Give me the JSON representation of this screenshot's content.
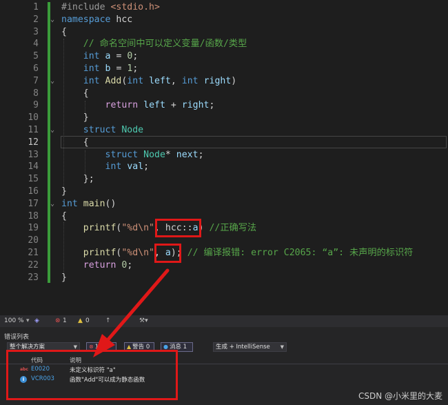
{
  "editor": {
    "lines": [
      {
        "n": "1",
        "html": "<span class='pp'>#include</span> <span class='str'>&lt;stdio.h&gt;</span>",
        "fold": ""
      },
      {
        "n": "2",
        "html": "<span class='kw'>namespace</span> <span class='plain'>hcc</span>",
        "fold": "⌄"
      },
      {
        "n": "3",
        "html": "<span class='plain'>{</span>",
        "fold": ""
      },
      {
        "n": "4",
        "html": "    <span class='cm'>// 命名空间中可以定义变量/函数/类型</span>",
        "fold": ""
      },
      {
        "n": "5",
        "html": "    <span class='kw'>int</span> <span class='var'>a</span> <span class='plain'>=</span> <span class='num'>0</span><span class='plain'>;</span>",
        "fold": ""
      },
      {
        "n": "6",
        "html": "    <span class='kw'>int</span> <span class='var'>b</span> <span class='plain'>=</span> <span class='num'>1</span><span class='plain'>;</span>",
        "fold": ""
      },
      {
        "n": "7",
        "html": "    <span class='kw'>int</span> <span class='fn'>Add</span><span class='plain'>(</span><span class='kw'>int</span> <span class='var'>left</span><span class='plain'>,</span> <span class='kw'>int</span> <span class='var'>right</span><span class='plain'>)</span>",
        "fold": "⌄"
      },
      {
        "n": "8",
        "html": "    <span class='plain'>{</span>",
        "fold": ""
      },
      {
        "n": "9",
        "html": "        <span class='kw2'>return</span> <span class='var'>left</span> <span class='plain'>+</span> <span class='var'>right</span><span class='plain'>;</span>",
        "fold": ""
      },
      {
        "n": "10",
        "html": "    <span class='plain'>}</span>",
        "fold": ""
      },
      {
        "n": "11",
        "html": "    <span class='kw'>struct</span> <span class='ty'>Node</span>",
        "fold": "⌄"
      },
      {
        "n": "12",
        "html": "    <span class='plain'>{</span>",
        "fold": ""
      },
      {
        "n": "13",
        "html": "        <span class='kw'>struct</span> <span class='ty'>Node</span><span class='plain'>*</span> <span class='var'>next</span><span class='plain'>;</span>",
        "fold": ""
      },
      {
        "n": "14",
        "html": "        <span class='kw'>int</span> <span class='var'>val</span><span class='plain'>;</span>",
        "fold": ""
      },
      {
        "n": "15",
        "html": "    <span class='plain'>};</span>",
        "fold": ""
      },
      {
        "n": "16",
        "html": "<span class='plain'>}</span>",
        "fold": ""
      },
      {
        "n": "17",
        "html": "<span class='kw'>int</span> <span class='fn'>main</span><span class='plain'>()</span>",
        "fold": "⌄"
      },
      {
        "n": "18",
        "html": "<span class='plain'>{</span>",
        "fold": ""
      },
      {
        "n": "19",
        "html": "    <span class='fn'>printf</span><span class='plain'>(</span><span class='str'>\"%d\\n\"</span><span class='plain'>,</span> <span class='plain'>hcc::</span><span class='var'>a</span><span class='plain'>)</span> <span class='cm'>//正确写法</span>",
        "fold": ""
      },
      {
        "n": "20",
        "html": "",
        "fold": ""
      },
      {
        "n": "21",
        "html": "    <span class='fn'>printf</span><span class='plain'>(</span><span class='str'>\"%d\\n\"</span><span class='plain'>,</span> <span class='var'>a</span><span class='plain'>);</span> <span class='cm'>// 编译报错: error C2065: “a”: 未声明的标识符</span>",
        "fold": ""
      },
      {
        "n": "22",
        "html": "    <span class='kw2'>return</span> <span class='num'>0</span><span class='plain'>;</span>",
        "fold": ""
      },
      {
        "n": "23",
        "html": "<span class='plain'>}</span>",
        "fold": ""
      }
    ],
    "current_line": "12"
  },
  "status": {
    "zoom": "100 %",
    "errors": "1",
    "warnings": "0"
  },
  "error_panel": {
    "title": "错误列表",
    "scope": "整个解决方案",
    "error_filter": "1",
    "warning_filter": "警告 0",
    "message_filter": "消息 1",
    "build_filter": "生成 + IntelliSense",
    "col_code": "代码",
    "col_desc": "说明",
    "rows": [
      {
        "icon": "abc",
        "code": "E0020",
        "desc": "未定义标识符 \"a\""
      },
      {
        "icon": "info",
        "code": "VCR003",
        "desc": "函数\"Add\"可以成为静态函数"
      }
    ]
  },
  "watermark": "CSDN @小米里的大麦",
  "colors": {
    "annotation_red": "#e01818",
    "change_bar_green": "#3b9c3b"
  }
}
